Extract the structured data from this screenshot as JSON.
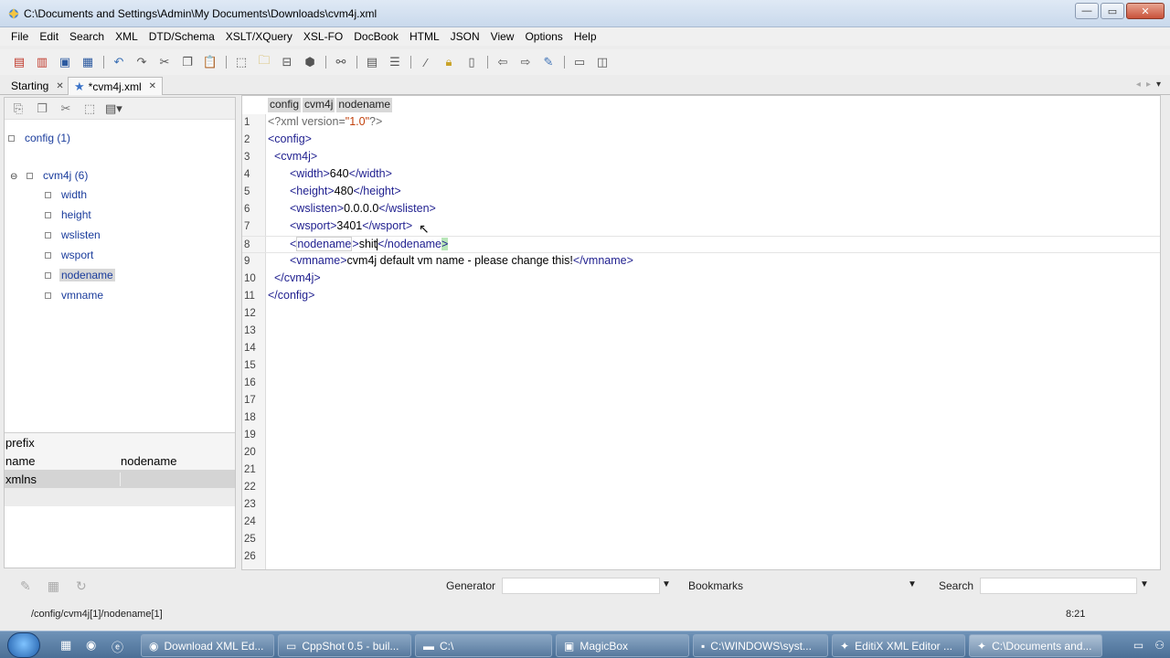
{
  "window": {
    "title": "C:\\Documents and Settings\\Admin\\My Documents\\Downloads\\cvm4j.xml",
    "minimize": "—",
    "maximize": "▭",
    "close": "✕"
  },
  "menu": [
    "File",
    "Edit",
    "Search",
    "XML",
    "DTD/Schema",
    "XSLT/XQuery",
    "XSL-FO",
    "DocBook",
    "HTML",
    "JSON",
    "View",
    "Options",
    "Help"
  ],
  "toolbar_icons": [
    "new-file-icon",
    "new-template-icon",
    "save-icon",
    "save-all-icon",
    "sep",
    "undo-icon",
    "redo-icon",
    "cut-icon",
    "copy-icon",
    "paste-icon",
    "sep",
    "select-icon",
    "folder-icon",
    "split-icon",
    "package-icon",
    "sep",
    "find-icon",
    "sep",
    "format-icon",
    "list-icon",
    "sep",
    "wand-icon",
    "lock-icon",
    "document-icon",
    "sep",
    "back-icon",
    "forward-icon",
    "pin-icon",
    "sep",
    "layout-horizontal-icon",
    "layout-vertical-icon"
  ],
  "tabs": [
    {
      "label": "Starting",
      "close": "✕"
    },
    {
      "label": "*cvm4j.xml",
      "close": "✕"
    }
  ],
  "tree": {
    "root": "config (1)",
    "parent": "cvm4j (6)",
    "children": [
      "width",
      "height",
      "wslisten",
      "wsport",
      "nodename",
      "vmname"
    ],
    "selected": "nodename"
  },
  "properties": {
    "prefix_label": "prefix",
    "name_label": "name",
    "name_value": "nodename",
    "xmlns_label": "xmlns"
  },
  "breadcrumb": [
    "config",
    "cvm4j",
    "nodename"
  ],
  "editor": {
    "line_numbers": [
      "1",
      "2",
      "3",
      "4",
      "5",
      "6",
      "7",
      "8",
      "9",
      "10",
      "11",
      "12",
      "13",
      "14",
      "15",
      "16",
      "17",
      "18",
      "19",
      "20",
      "21",
      "22",
      "23",
      "24",
      "25",
      "26"
    ],
    "lines": {
      "l1_open": "<?xml version=",
      "l1_val": "\"1.0\"",
      "l1_close": "?>",
      "l2": "<config>",
      "l3": "  <cvm4j>",
      "l4_tag": "<width>",
      "l4_val": "640",
      "l4_end": "</width>",
      "l5_tag": "<height>",
      "l5_val": "480",
      "l5_end": "</height>",
      "l6_tag": "<wslisten>",
      "l6_val": "0.0.0.0",
      "l6_end": "</wslisten>",
      "l7_tag": "<wsport>",
      "l7_val": "3401",
      "l7_end": "</wsport>",
      "l8_open": "<",
      "l8_name": "nodename",
      "l8_gt": ">",
      "l8_val": "shit",
      "l8_end1": "</nodename",
      "l8_end2": ">",
      "l9_tag": "<vmname>",
      "l9_val": "cvm4j default vm name - please change this!",
      "l9_end": "</vmname>",
      "l10": "  </cvm4j>",
      "l11": "</config>"
    }
  },
  "bottom": {
    "generator_label": "Generator",
    "bookmarks_label": "Bookmarks",
    "search_label": "Search"
  },
  "status": {
    "path": "/config/cvm4j[1]/nodename[1]",
    "position": "8:21"
  },
  "taskbar": {
    "items": [
      {
        "label": "Download XML Ed...",
        "icon": "firefox-icon"
      },
      {
        "label": "CppShot 0.5 - buil...",
        "icon": "window-icon"
      },
      {
        "label": "C:\\",
        "icon": "folder-icon"
      },
      {
        "label": "MagicBox",
        "icon": "app-icon"
      },
      {
        "label": "C:\\WINDOWS\\syst...",
        "icon": "cmd-icon"
      },
      {
        "label": "EditiX XML Editor ...",
        "icon": "editix-icon"
      },
      {
        "label": "C:\\Documents and...",
        "icon": "editix-icon"
      }
    ]
  }
}
